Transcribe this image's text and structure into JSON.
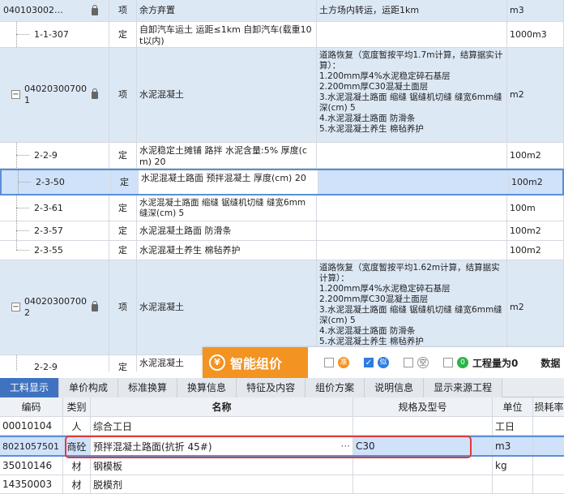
{
  "top_rows": [
    {
      "code": "040103002…",
      "type": "项",
      "name": "余方弃置",
      "spec": "土方场内转运，运距1km",
      "unit": "m3"
    },
    {
      "code": "1-1-307",
      "type": "定",
      "name": "自卸汽车运土 运距≤1km 自卸汽车(载重10t以内)",
      "spec": "",
      "unit": "1000m3"
    },
    {
      "code": "04020300700\n1",
      "type": "项",
      "name": "水泥混凝土",
      "spec": "道路恢复（宽度暂按平均1.7m计算，结算据实计算）：\n1.200mm厚4%水泥稳定碎石基层\n2.200mm厚C30混凝土面层\n3.水泥混凝土路面 缩缝 锯缝机切缝 缝宽6mm缝深(cm) 5\n4.水泥混凝土路面 防滑条\n5.水泥混凝土养生 棉毡养护",
      "unit": "m2"
    },
    {
      "code": "2-2-9",
      "type": "定",
      "name": "水泥稳定土摊铺 路拌 水泥含量:5% 厚度(cm) 20",
      "spec": "",
      "unit": "100m2"
    },
    {
      "code": "2-3-50",
      "type": "定",
      "name": "水泥混凝土路面 预拌混凝土 厚度(cm) 20",
      "spec": "",
      "unit": "100m2"
    },
    {
      "code": "2-3-61",
      "type": "定",
      "name": "水泥混凝土路面 缩缝 锯缝机切缝 缝宽6mm缝深(cm) 5",
      "spec": "",
      "unit": "100m"
    },
    {
      "code": "2-3-57",
      "type": "定",
      "name": "水泥混凝土路面 防滑条",
      "spec": "",
      "unit": "100m2"
    },
    {
      "code": "2-3-55",
      "type": "定",
      "name": "水泥混凝土养生 棉毡养护",
      "spec": "",
      "unit": "100m2"
    },
    {
      "code": "04020300700\n2",
      "type": "项",
      "name": "水泥混凝土",
      "spec": "道路恢复（宽度暂按平均1.62m计算，结算据实计算）：\n1.200mm厚4%水泥稳定碎石基层\n2.200mm厚C30混凝土面层\n3.水泥混凝土路面 缩缝 锯缝机切缝 缝宽6mm缝深(cm) 5\n4.水泥混凝土路面 防滑条\n5.水泥混凝土养生 棉毡养护",
      "unit": "m2"
    },
    {
      "code": "2-2-9",
      "type": "定",
      "name": "水泥混凝土",
      "spec": "",
      "unit": ""
    }
  ],
  "banner": {
    "title": "智能组价",
    "opt1": "准",
    "opt2": "似",
    "opt3": "空",
    "opt4_icon": "0",
    "opt4_label": "工程量为0",
    "opt5_label": "数据"
  },
  "tabs": [
    "工料显示",
    "单价构成",
    "标准换算",
    "换算信息",
    "特征及内容",
    "组价方案",
    "说明信息",
    "显示来源工程"
  ],
  "grid": {
    "headers": [
      "编码",
      "类别",
      "名称",
      "规格及型号",
      "单位",
      "损耗率"
    ],
    "rows": [
      {
        "code": "00010104",
        "cat": "人",
        "name": "综合工日",
        "spec": "",
        "unit": "工日"
      },
      {
        "code": "8021057501",
        "cat": "商砼",
        "name": "预拌混凝土路面(抗折 45#)",
        "spec": "C30",
        "unit": "m3"
      },
      {
        "code": "35010146",
        "cat": "材",
        "name": "钢模板",
        "spec": "",
        "unit": "kg"
      },
      {
        "code": "14350003",
        "cat": "材",
        "name": "脱模剂",
        "spec": "",
        "unit": ""
      }
    ]
  },
  "colors": {
    "selected_bg": "#cfe2fa",
    "banner_orange": "#f39321",
    "tab_active": "#3f73c0",
    "highlight_red": "#e23a3a"
  }
}
